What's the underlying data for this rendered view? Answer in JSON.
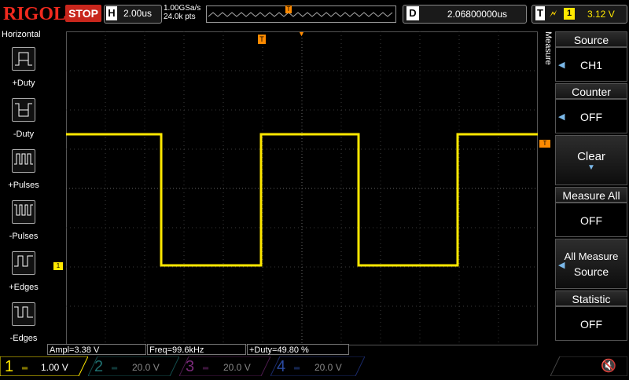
{
  "header": {
    "brand": "RIGOL",
    "run_state": "STOP",
    "timebase_key": "H",
    "timebase": "2.00us",
    "sample_rate": "1.00GSa/s",
    "memory_depth": "24.0k pts",
    "trigger_marker": "T",
    "delay_key": "D",
    "delay": "2.06800000us",
    "trigger_key": "T",
    "trigger_source": "1",
    "trigger_level": "3.12 V"
  },
  "left_menu": {
    "title": "Horizontal",
    "items": [
      {
        "label": "+Duty",
        "icon": "positive-duty-icon"
      },
      {
        "label": "-Duty",
        "icon": "negative-duty-icon"
      },
      {
        "label": "+Pulses",
        "icon": "positive-pulses-icon"
      },
      {
        "label": "-Pulses",
        "icon": "negative-pulses-icon"
      },
      {
        "label": "+Edges",
        "icon": "positive-edges-icon"
      },
      {
        "label": "-Edges",
        "icon": "negative-edges-icon"
      }
    ]
  },
  "right_menu": {
    "tab": "Measure",
    "items": [
      {
        "head": "Source",
        "value": "CH1"
      },
      {
        "head": "Counter",
        "value": "OFF"
      },
      {
        "head": "Clear",
        "value": ""
      },
      {
        "head": "Measure All",
        "value": "OFF"
      },
      {
        "head": "All Measure",
        "value": "Source"
      },
      {
        "head": "Statistic",
        "value": "OFF"
      }
    ]
  },
  "measurements": [
    {
      "label": "Ampl=3.38 V"
    },
    {
      "label": "Freq=99.6kHz"
    },
    {
      "label": "+Duty=49.80 %"
    }
  ],
  "channel_marker": "1",
  "trigger_level_marker": "T",
  "channels": [
    {
      "num": "1",
      "scale": "1.00 V",
      "color": "#ffe800"
    },
    {
      "num": "2",
      "scale": "20.0 V",
      "color": "#00c8c8"
    },
    {
      "num": "3",
      "scale": "20.0 V",
      "color": "#d040d0"
    },
    {
      "num": "4",
      "scale": "20.0 V",
      "color": "#4070ff"
    }
  ],
  "colors": {
    "ch1": "#ffe800",
    "brand": "#f02a1e",
    "trigger": "#ff8a00"
  }
}
